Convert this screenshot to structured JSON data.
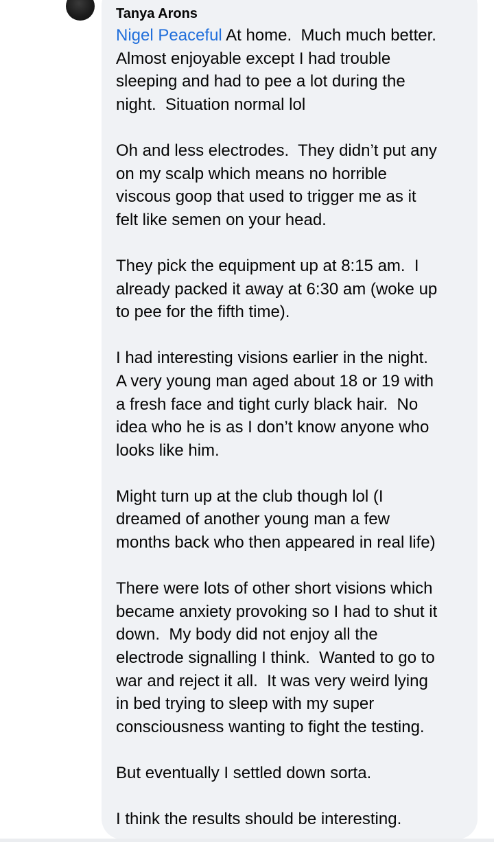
{
  "comment": {
    "author": "Tanya Arons",
    "mention": "Nigel Peaceful",
    "paragraphs": [
      " At home.  Much much better.\nAlmost enjoyable except I had trouble\nsleeping and had to pee a lot during the\nnight.  Situation normal lol",
      "Oh and less electrodes.  They didn’t put any\non my scalp which means no horrible\nviscous goop that used to trigger me as it\nfelt like semen on your head.",
      "They pick the equipment up at 8:15 am.  I\nalready packed it away at 6:30 am (woke up\nto pee for the fifth time).",
      "I had interesting visions earlier in the night.\nA very young man aged about 18 or 19 with\na fresh face and tight curly black hair.  No\nidea who he is as I don’t know anyone who\nlooks like him.",
      "Might turn up at the club though lol (I\ndreamed of another young man a few\nmonths back who then appeared in real life)",
      "There were lots of other short visions which\nbecame anxiety provoking so I had to shut it\ndown.  My body did not enjoy all the\nelectrode signalling I think.  Wanted to go to\nwar and reject it all.  It was very weird lying\nin bed trying to sleep with my super\nconsciousness wanting to fight the testing.",
      "But eventually I settled down sorta.",
      "I think the results should be interesting."
    ]
  }
}
